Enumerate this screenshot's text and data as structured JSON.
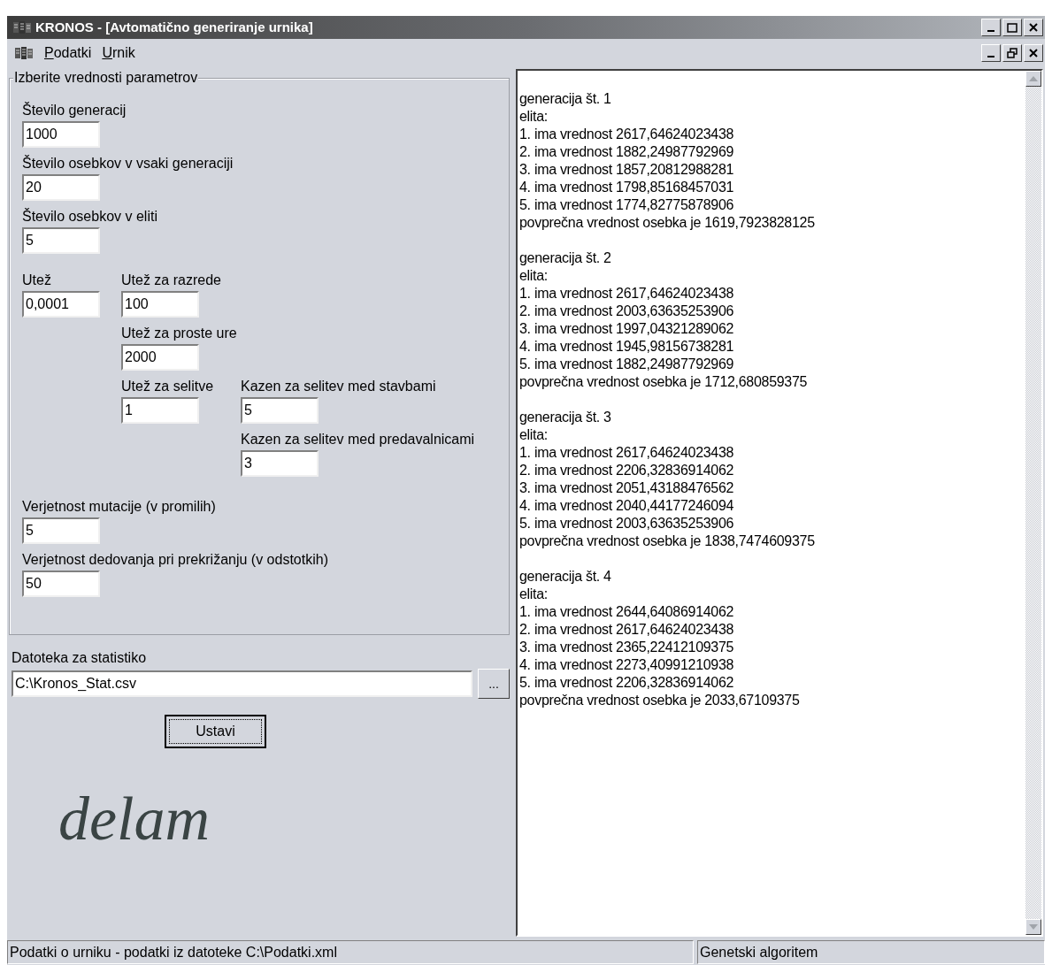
{
  "window": {
    "title": "KRONOS - [Avtomatično generiranje urnika]"
  },
  "menu": [
    {
      "label": "Podatki"
    },
    {
      "label": "Urnik"
    }
  ],
  "parameters": {
    "legend": "Izberite vrednosti parametrov",
    "fields": [
      {
        "label": "Število generacij",
        "value": "1000"
      },
      {
        "label": "Število osebkov v vsaki generaciji",
        "value": "20"
      },
      {
        "label": "Število osebkov v eliti",
        "value": "5"
      },
      {
        "label": "Utež",
        "value": "0,0001"
      },
      {
        "label": "Utež za razrede",
        "value": "100"
      },
      {
        "label": "Utež za proste ure",
        "value": "2000"
      },
      {
        "label": "Utež za selitve",
        "value": "1"
      },
      {
        "label": "Kazen za selitev med stavbami",
        "value": "5"
      },
      {
        "label": "Kazen za selitev med predavalnicami",
        "value": "3"
      },
      {
        "label": "Verjetnost mutacije (v promilih)",
        "value": "5"
      },
      {
        "label": "Verjetnost dedovanja pri prekrižanju (v odstotkih)",
        "value": "50"
      }
    ]
  },
  "stats_file": {
    "label": "Datoteka za statistiko",
    "value": "C:\\Kronos_Stat.csv",
    "browse": "..."
  },
  "stop_button": "Ustavi",
  "busy_text": "delam",
  "log": [
    [
      "generacija št. 1",
      "elita:",
      "1. ima vrednost 2617,64624023438",
      "2. ima vrednost 1882,24987792969",
      "3. ima vrednost 1857,20812988281",
      "4. ima vrednost 1798,85168457031",
      "5. ima vrednost 1774,82775878906",
      "povprečna vrednost osebka je 1619,7923828125"
    ],
    [
      "generacija št. 2",
      "elita:",
      "1. ima vrednost 2617,64624023438",
      "2. ima vrednost 2003,63635253906",
      "3. ima vrednost 1997,04321289062",
      "4. ima vrednost 1945,98156738281",
      "5. ima vrednost 1882,24987792969",
      "povprečna vrednost osebka je 1712,680859375"
    ],
    [
      "generacija št. 3",
      "elita:",
      "1. ima vrednost 2617,64624023438",
      "2. ima vrednost 2206,32836914062",
      "3. ima vrednost 2051,43188476562",
      "4. ima vrednost 2040,44177246094",
      "5. ima vrednost 2003,63635253906",
      "povprečna vrednost osebka je 1838,7474609375"
    ],
    [
      "generacija št. 4",
      "elita:",
      "1. ima vrednost 2644,64086914062",
      "2. ima vrednost 2617,64624023438",
      "3. ima vrednost 2365,22412109375",
      "4. ima vrednost 2273,40991210938",
      "5. ima vrednost 2206,32836914062",
      "povprečna vrednost osebka je 2033,67109375"
    ]
  ],
  "status_bar": [
    "Podatki o urniku - podatki iz datoteke C:\\Podatki.xml",
    "Genetski algoritem"
  ]
}
